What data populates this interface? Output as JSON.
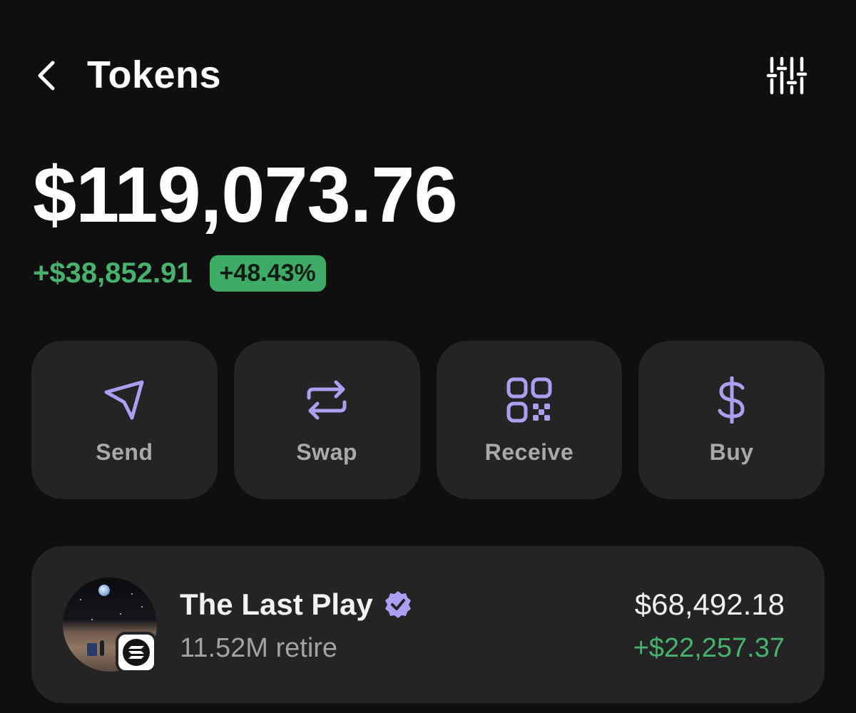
{
  "header": {
    "title": "Tokens",
    "back_icon": "chevron-left-icon",
    "filter_icon": "sliders-icon"
  },
  "portfolio": {
    "balance": "$119,073.76",
    "change_amount": "+$38,852.91",
    "change_percent": "+48.43%"
  },
  "actions": [
    {
      "label": "Send",
      "icon": "send-icon"
    },
    {
      "label": "Swap",
      "icon": "swap-icon"
    },
    {
      "label": "Receive",
      "icon": "qr-code-icon"
    },
    {
      "label": "Buy",
      "icon": "dollar-icon"
    }
  ],
  "tokens": [
    {
      "name": "The Last Play",
      "amount": "11.52M retire",
      "value": "$68,492.18",
      "change": "+$22,257.37",
      "verified": true,
      "chain_icon": "solana-icon"
    }
  ],
  "colors": {
    "background": "#0f0f0f",
    "card": "#242424",
    "accent_purple": "#ab9ff2",
    "positive_green": "#47b26e",
    "badge_green": "#3eab67"
  }
}
